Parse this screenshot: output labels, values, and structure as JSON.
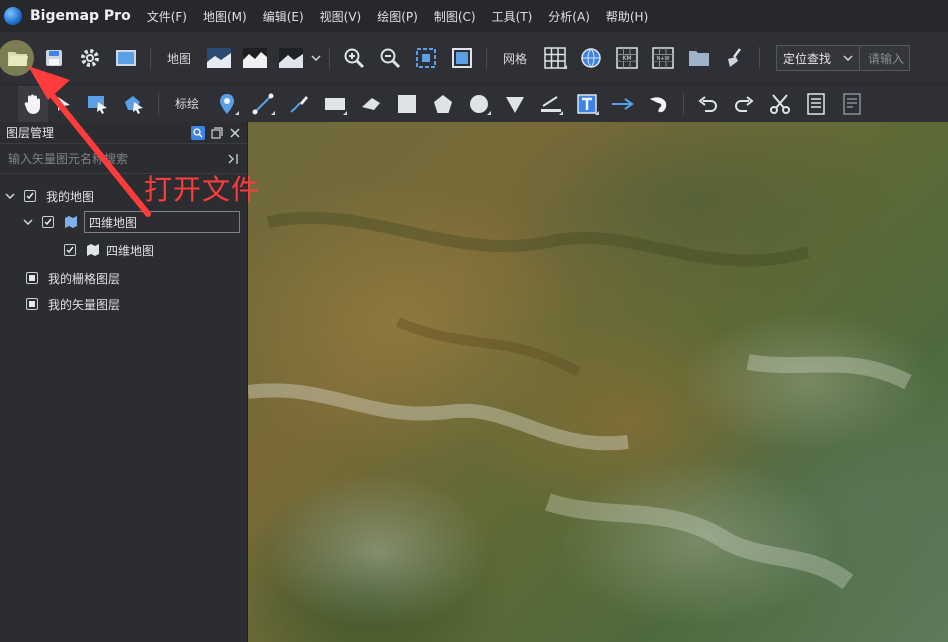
{
  "app": {
    "title": "Bigemap Pro"
  },
  "menu": [
    "文件(F)",
    "地图(M)",
    "编辑(E)",
    "视图(V)",
    "绘图(P)",
    "制图(C)",
    "工具(T)",
    "分析(A)",
    "帮助(H)"
  ],
  "toolbar1": {
    "map_label": "地图",
    "grid_label": "网格",
    "locate_label": "定位查找",
    "locate_placeholder": "请输入"
  },
  "toolbar2": {
    "annotate_label": "标绘"
  },
  "layer_panel": {
    "title": "图层管理",
    "search_placeholder": "输入矢量图元名称搜索",
    "tree": {
      "my_map": "我的地图",
      "layer_group": "四维地图",
      "layer_child": "四维地图",
      "raster": "我的栅格图层",
      "vector": "我的矢量图层"
    }
  },
  "annotation": {
    "text": "打开文件",
    "color": "#ff3b3b"
  },
  "colors": {
    "accent": "#3d83e8",
    "menubar": "#26282c",
    "toolbar": "#2e3035"
  }
}
